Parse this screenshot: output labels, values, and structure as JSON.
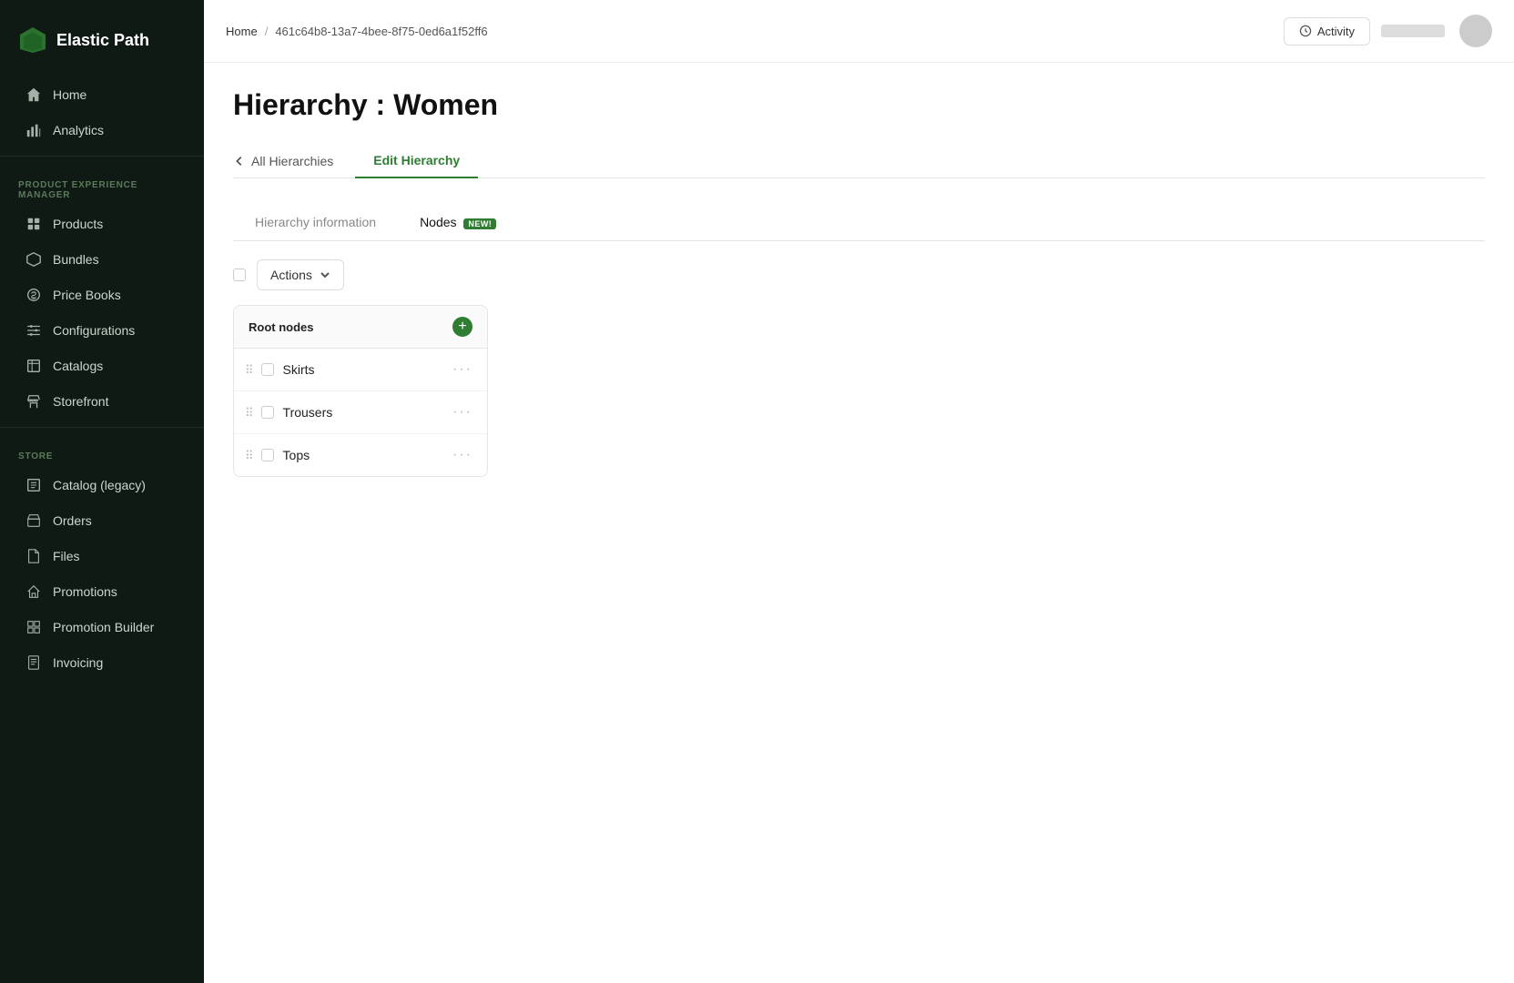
{
  "app": {
    "name": "Elastic Path",
    "logo_icon": "⬡"
  },
  "sidebar": {
    "top_nav": [
      {
        "id": "home",
        "label": "Home",
        "icon": "home"
      },
      {
        "id": "analytics",
        "label": "Analytics",
        "icon": "chart"
      }
    ],
    "pem_section_label": "PRODUCT EXPERIENCE MANAGER",
    "pem_items": [
      {
        "id": "products",
        "label": "Products",
        "icon": "box"
      },
      {
        "id": "bundles",
        "label": "Bundles",
        "icon": "bundle"
      },
      {
        "id": "price-books",
        "label": "Price Books",
        "icon": "tag"
      },
      {
        "id": "configurations",
        "label": "Configurations",
        "icon": "sliders"
      },
      {
        "id": "catalogs",
        "label": "Catalogs",
        "icon": "catalog"
      },
      {
        "id": "storefront",
        "label": "Storefront",
        "icon": "store"
      }
    ],
    "store_section_label": "STORE",
    "store_items": [
      {
        "id": "catalog-legacy",
        "label": "Catalog (legacy)",
        "icon": "catalog2"
      },
      {
        "id": "orders",
        "label": "Orders",
        "icon": "orders"
      },
      {
        "id": "files",
        "label": "Files",
        "icon": "files"
      },
      {
        "id": "promotions",
        "label": "Promotions",
        "icon": "promo"
      },
      {
        "id": "promotion-builder",
        "label": "Promotion Builder",
        "icon": "builder"
      },
      {
        "id": "invoicing",
        "label": "Invoicing",
        "icon": "invoice"
      }
    ]
  },
  "topbar": {
    "breadcrumb_home": "Home",
    "breadcrumb_id": "461c64b8-13a7-4bee-8f75-0ed6a1f52ff6",
    "activity_label": "Activity"
  },
  "page": {
    "title": "Hierarchy : Women",
    "tab_back_label": "All Hierarchies",
    "tab_active_label": "Edit Hierarchy",
    "panel_info_label": "Hierarchy information",
    "panel_nodes_label": "Nodes",
    "nodes_badge": "NEW!",
    "toolbar": {
      "actions_label": "Actions"
    },
    "root_nodes": {
      "title": "Root nodes",
      "items": [
        {
          "id": 1,
          "name": "Skirts"
        },
        {
          "id": 2,
          "name": "Trousers"
        },
        {
          "id": 3,
          "name": "Tops"
        }
      ]
    }
  }
}
